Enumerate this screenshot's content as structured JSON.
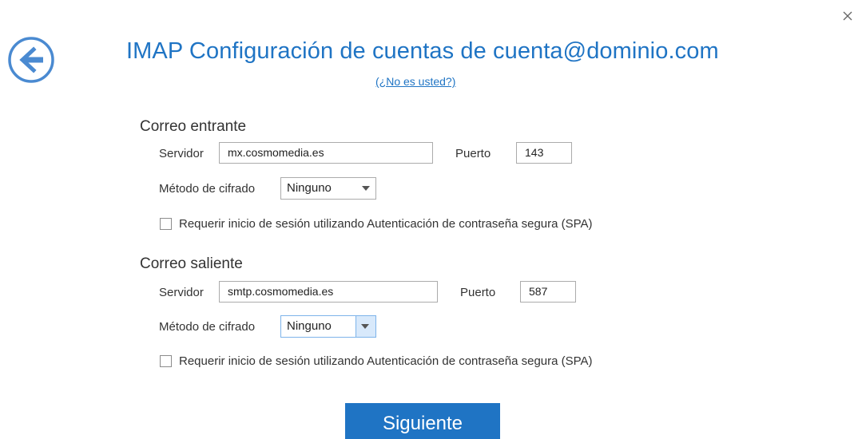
{
  "header": {
    "title": "IMAP Configuración de cuentas de cuenta@dominio.com",
    "not_you_link": "(¿No es usted?)"
  },
  "incoming": {
    "section_title": "Correo entrante",
    "server_label": "Servidor",
    "server_value": "mx.cosmomedia.es",
    "port_label": "Puerto",
    "port_value": "143",
    "encryption_label": "Método de cifrado",
    "encryption_value": "Ninguno",
    "spa_label": "Requerir inicio de sesión utilizando Autenticación de contraseña segura (SPA)",
    "spa_checked": false
  },
  "outgoing": {
    "section_title": "Correo saliente",
    "server_label": "Servidor",
    "server_value": "smtp.cosmomedia.es",
    "port_label": "Puerto",
    "port_value": "587",
    "encryption_label": "Método de cifrado",
    "encryption_value": "Ninguno",
    "spa_label": "Requerir inicio de sesión utilizando Autenticación de contraseña segura (SPA)",
    "spa_checked": false
  },
  "footer": {
    "next_label": "Siguiente"
  },
  "colors": {
    "accent": "#1f74c4",
    "back_icon": "#4a8ad1"
  },
  "icons": {
    "close": "close-icon",
    "back": "back-arrow-icon",
    "dropdown": "chevron-down-icon"
  }
}
